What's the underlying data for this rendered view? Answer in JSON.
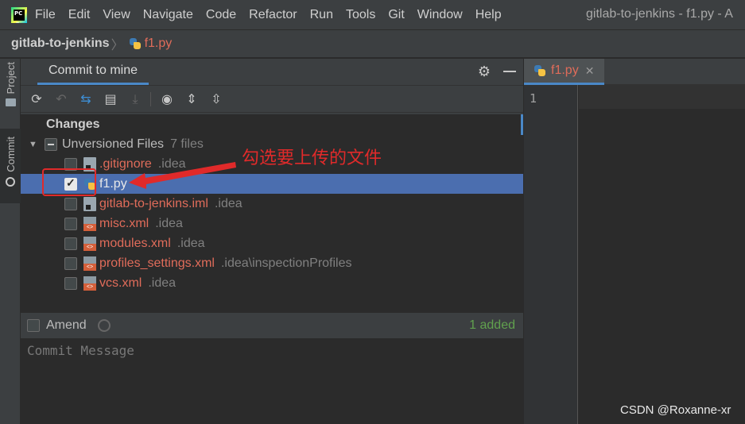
{
  "menubar": {
    "items": [
      "File",
      "Edit",
      "View",
      "Navigate",
      "Code",
      "Refactor",
      "Run",
      "Tools",
      "Git",
      "Window",
      "Help"
    ],
    "title": "gitlab-to-jenkins - f1.py - A"
  },
  "breadcrumb": {
    "project": "gitlab-to-jenkins",
    "file": "f1.py"
  },
  "left_strip": {
    "project_label": "Project",
    "commit_label": "Commit"
  },
  "commit_panel": {
    "tab_title": "Commit to mine",
    "toolbar_icons": [
      "refresh-icon",
      "rollback-icon",
      "diff-icon",
      "show-diff-icon",
      "shelve-icon",
      "view-options-icon",
      "expand-all-icon",
      "collapse-all-icon"
    ],
    "changes_label": "Changes",
    "group": {
      "label": "Unversioned Files",
      "count": "7 files"
    },
    "files": [
      {
        "name": ".gitignore",
        "path": ".idea",
        "checked": false,
        "icon": "ignore-file-icon"
      },
      {
        "name": "f1.py",
        "path": "",
        "checked": true,
        "icon": "python-file-icon"
      },
      {
        "name": "gitlab-to-jenkins.iml",
        "path": ".idea",
        "checked": false,
        "icon": "module-file-icon"
      },
      {
        "name": "misc.xml",
        "path": ".idea",
        "checked": false,
        "icon": "xml-file-icon"
      },
      {
        "name": "modules.xml",
        "path": ".idea",
        "checked": false,
        "icon": "xml-file-icon"
      },
      {
        "name": "profiles_settings.xml",
        "path": ".idea\\inspectionProfiles",
        "checked": false,
        "icon": "xml-file-icon"
      },
      {
        "name": "vcs.xml",
        "path": ".idea",
        "checked": false,
        "icon": "xml-file-icon"
      }
    ],
    "amend_label": "Amend",
    "added_status": "1 added",
    "message_placeholder": "Commit Message"
  },
  "editor": {
    "tab_name": "f1.py",
    "line_numbers": [
      "1"
    ]
  },
  "annotation": {
    "text": "勾选要上传的文件",
    "color": "#e02a2a"
  },
  "watermark": "CSDN @Roxanne-xr",
  "colors": {
    "accent": "#4a88c7",
    "selection": "#4b6eaf",
    "unversioned_text": "#e06c5a",
    "added_text": "#61a14e"
  }
}
